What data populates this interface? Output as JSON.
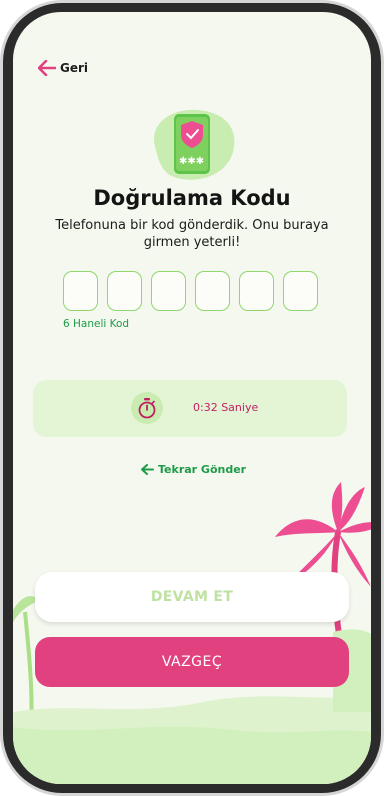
{
  "header": {
    "back_label": "Geri"
  },
  "main": {
    "title": "Doğrulama Kodu",
    "subtitle": "Telefonuna bir kod gönderdik. Onu buraya girmen yeterli!",
    "code_hint": "6 Haneli Kod",
    "code_digits": [
      "",
      "",
      "",
      "",
      "",
      ""
    ],
    "timer_text": "0:32 Saniye",
    "resend_label": "Tekrar Gönder"
  },
  "actions": {
    "continue_label": "DEVAM ET",
    "cancel_label": "VAZGEÇ"
  },
  "icons": {
    "back": "arrow-left-icon",
    "illustration": "phone-shield-icon",
    "timer": "stopwatch-icon",
    "resend": "arrow-left-icon"
  },
  "colors": {
    "accent_pink": "#e1417f",
    "accent_green": "#1f9b48",
    "light_green": "#8fd66e",
    "screen_bg": "#f4f8ef"
  }
}
